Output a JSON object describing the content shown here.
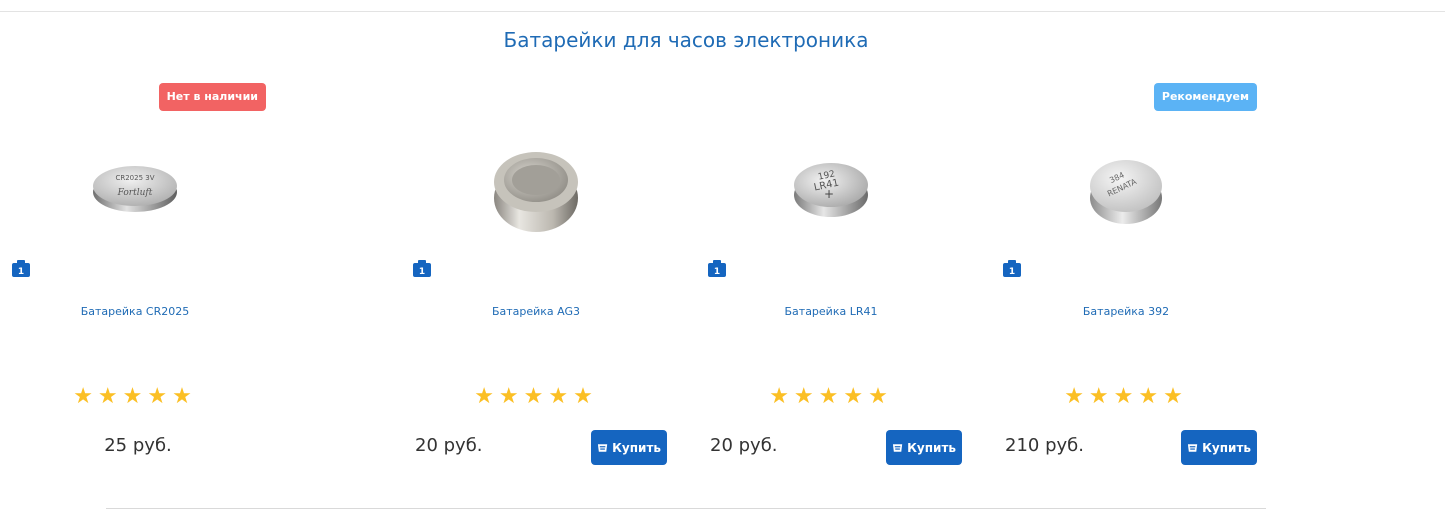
{
  "section": {
    "title": "Батарейки для часов электроника"
  },
  "products": [
    {
      "name": "Батарейка AG3",
      "price": "20 руб.",
      "quantity_badge": "1",
      "rating_stars": "★★★★★",
      "rating": 5,
      "buy_label": "Купить",
      "badge": ""
    },
    {
      "name": "Батарейка LR41",
      "price": "20 руб.",
      "quantity_badge": "1",
      "rating_stars": "★★★★★",
      "rating": 5,
      "buy_label": "Купить",
      "badge": ""
    },
    {
      "name": "Батарейка 392",
      "price": "210 руб.",
      "quantity_badge": "1",
      "rating_stars": "★★★★★",
      "rating": 5,
      "buy_label": "Купить",
      "badge": "Рекомендуем"
    },
    {
      "name": "Батарейка CR2025",
      "price": "25 руб.",
      "quantity_badge": "1",
      "rating_stars": "★★★★★",
      "rating": 5,
      "buy_label": "",
      "badge": "Нет в наличии"
    }
  ],
  "image_labels": {
    "lr41": [
      "192",
      "LR41"
    ],
    "renata": [
      "384",
      "RENATA"
    ],
    "cr2025": [
      "CR2025 3V",
      "Fortluft"
    ]
  },
  "colors": {
    "link": "#1f6bb5",
    "buy_button": "#1565c0",
    "badge_recommend": "#5bb3f5",
    "badge_out_of_stock": "#f26363",
    "star": "#fbbf24"
  }
}
